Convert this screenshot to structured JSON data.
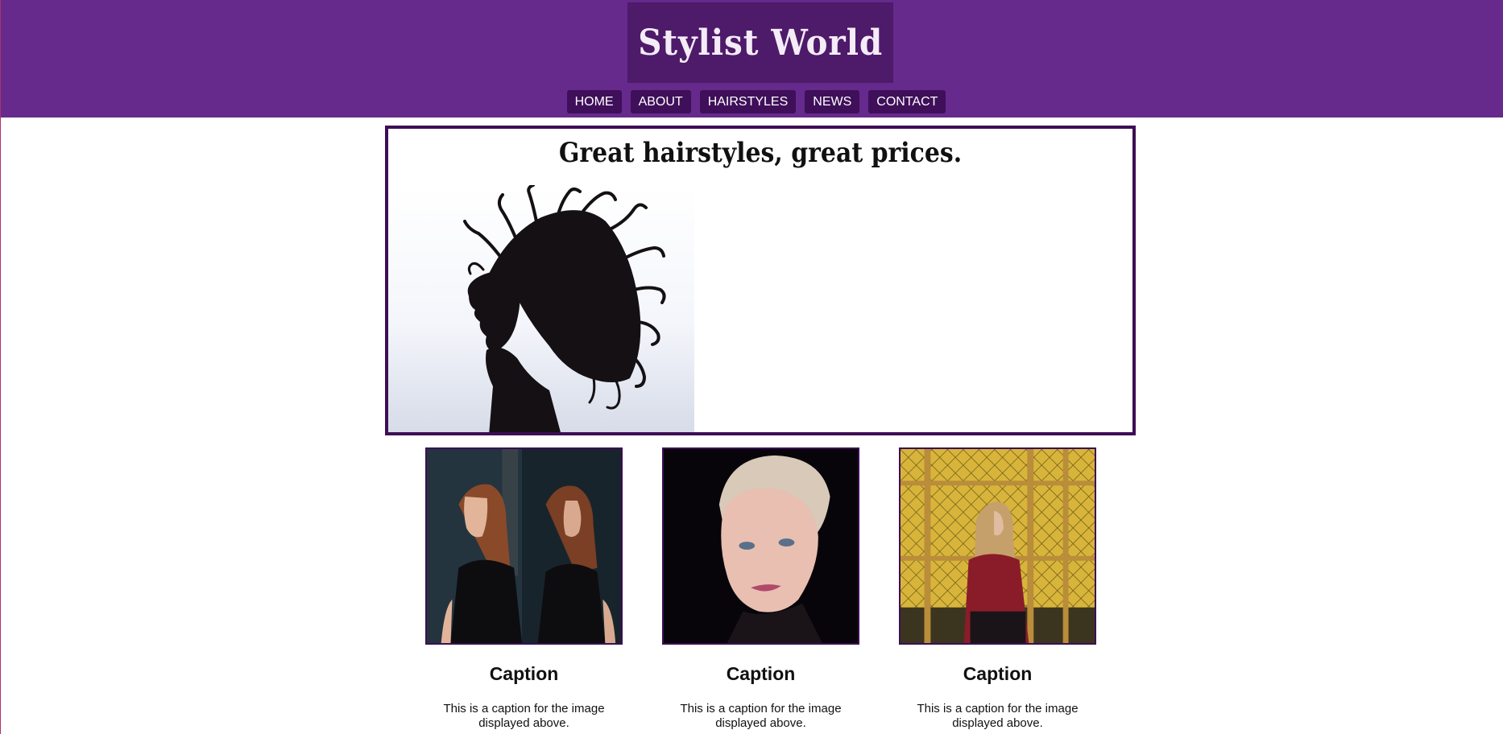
{
  "site": {
    "title": "Stylist World",
    "colors": {
      "header": "#652a8c",
      "logo_bg": "#4e1a6a",
      "nav_bg": "#3f0f5a",
      "border": "#3d0e55"
    }
  },
  "nav": {
    "items": [
      {
        "label": "HOME"
      },
      {
        "label": "ABOUT"
      },
      {
        "label": "HAIRSTYLES"
      },
      {
        "label": "NEWS"
      },
      {
        "label": "CONTACT"
      }
    ]
  },
  "hero": {
    "heading": "Great hairstyles, great prices.",
    "image": "woman-hair-flip-silhouette-photo"
  },
  "gallery": [
    {
      "image": "woman-mirror-reflection-photo",
      "title": "Caption",
      "text": "This is a caption for the image displayed above."
    },
    {
      "image": "woman-short-blonde-hair-photo",
      "title": "Caption",
      "text": "This is a caption for the image displayed above."
    },
    {
      "image": "woman-long-hair-fence-photo",
      "title": "Caption",
      "text": "This is a caption for the image displayed above."
    }
  ]
}
